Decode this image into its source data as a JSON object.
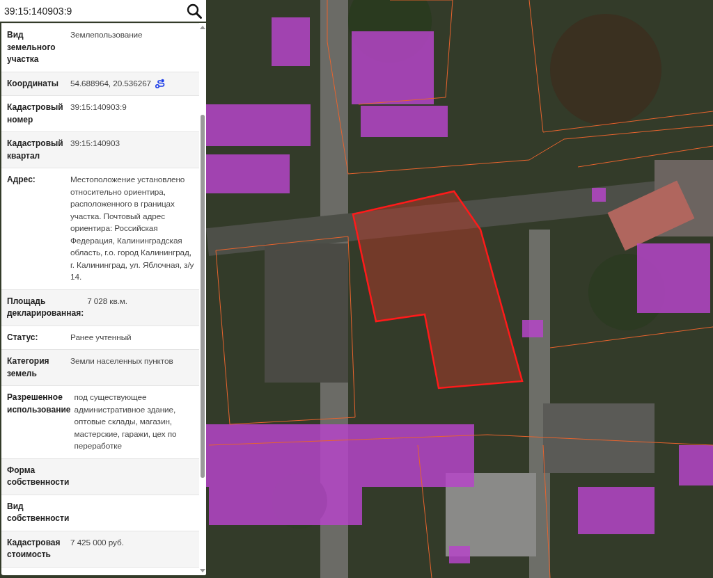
{
  "search": {
    "value": "39:15:140903:9"
  },
  "rows": [
    {
      "kind": "text",
      "label": "Вид земельного участка",
      "value": "Землепользование"
    },
    {
      "kind": "coordinates",
      "label": "Координаты",
      "value": "54.688964, 20.536267"
    },
    {
      "kind": "text",
      "label": "Кадастровый номер",
      "value": "39:15:140903:9"
    },
    {
      "kind": "text",
      "label": "Кадастровый квартал",
      "value": "39:15:140903"
    },
    {
      "kind": "text",
      "label": "Адрес:",
      "value": "Местоположение установлено относительно ориентира, расположенного в границах участка. Почтовый адрес ориентира: Российская Федерация, Калининградская область, г.о. город Калининград, г. Калининград, ул. Яблочная, з/у 14."
    },
    {
      "kind": "text",
      "label": "Площадь декларированная:",
      "value": "7 028 кв.м."
    },
    {
      "kind": "text",
      "label": "Статус:",
      "value": "Ранее учтенный"
    },
    {
      "kind": "text",
      "label": "Категория земель",
      "value": "Земли населенных пунктов"
    },
    {
      "kind": "text",
      "label": "Разрешенное использование",
      "value": "под существующее административное здание, оптовые склады, магазин, мастерские, гаражи, цех по переработке"
    },
    {
      "kind": "text",
      "label": "Форма собственности"
    },
    {
      "kind": "text",
      "label": "Вид собственности"
    },
    {
      "kind": "text",
      "label": "Кадастровая стоимость",
      "value": "7 425 000 руб."
    }
  ]
}
